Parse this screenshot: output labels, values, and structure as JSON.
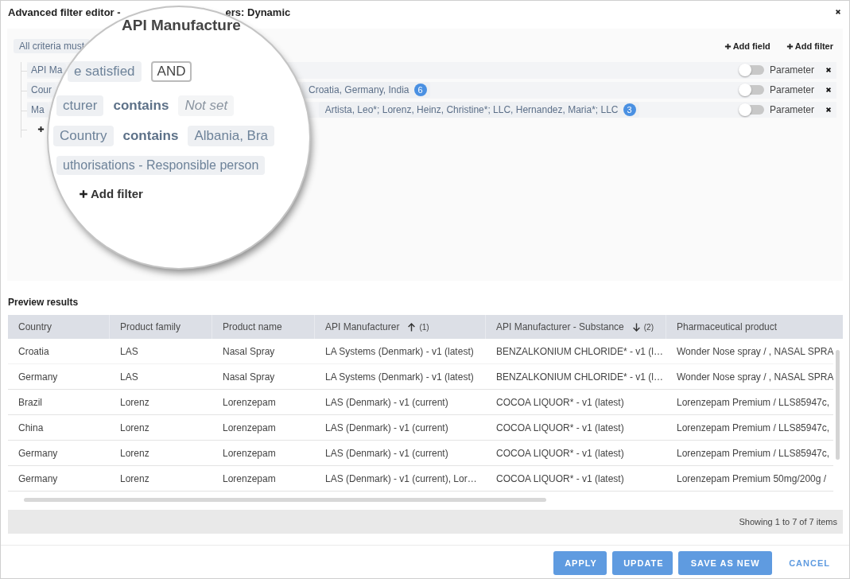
{
  "window": {
    "title_parts": [
      "Advanced filter editor -",
      "ers: Dynamic"
    ]
  },
  "filter": {
    "criteria": "All criteria must",
    "actions": [
      {
        "label": "Add field"
      },
      {
        "label": "Add filter"
      }
    ],
    "rows": [
      {
        "field": "API Ma",
        "parameter": "Parameter",
        "parameter_on": false
      },
      {
        "field": "Cour",
        "value": "Croatia, Germany, India",
        "count": "6",
        "parameter": "Parameter",
        "parameter_on": false
      },
      {
        "field": "Ma",
        "value": "Artista, Leo*; Lorenz, Heinz, Christine*; LLC, Hernandez, Maria*; LLC",
        "count": "3",
        "parameter": "Parameter",
        "parameter_on": false
      }
    ]
  },
  "magnifier": {
    "heading": "API Manufacture",
    "criteria": "e satisfied",
    "operator": "AND",
    "rows": [
      {
        "field": "cturer",
        "op": "contains",
        "value": "Not set",
        "kind": "placeholder"
      },
      {
        "field": "Country",
        "op": "contains",
        "value": "Albania, Bra",
        "kind": "text"
      },
      {
        "field": "uthorisations - Responsible person"
      }
    ],
    "add": "Add filter"
  },
  "preview": {
    "title": "Preview results",
    "columns": [
      {
        "label": "Country"
      },
      {
        "label": "Product family"
      },
      {
        "label": "Product name"
      },
      {
        "label": "API Manufacturer",
        "sorted": true,
        "descending": false,
        "sort_order": "(1)"
      },
      {
        "label": "API Manufacturer - Substance",
        "sorted": true,
        "descending": true,
        "sort_order": "(2)"
      },
      {
        "label": "Pharmaceutical product"
      }
    ],
    "rows": [
      [
        "Croatia",
        "LAS",
        "Nasal Spray",
        "LA Systems (Denmark) - v1 (latest)",
        "BENZALKONIUM CHLORIDE* - v1 (l…",
        "Wonder Nose spray / , NASAL SPRA"
      ],
      [
        "Germany",
        "LAS",
        "Nasal Spray",
        "LA Systems (Denmark) - v1 (latest)",
        "BENZALKONIUM CHLORIDE* - v1 (l…",
        "Wonder Nose spray / , NASAL SPRA"
      ],
      [
        "Brazil",
        "Lorenz",
        "Lorenzepam",
        "LAS (Denmark) - v1 (current)",
        "COCOA LIQUOR* - v1 (latest)",
        "Lorenzepam Premium / LLS85947c,"
      ],
      [
        "China",
        "Lorenz",
        "Lorenzepam",
        "LAS (Denmark) - v1 (current)",
        "COCOA LIQUOR* - v1 (latest)",
        "Lorenzepam Premium / LLS85947c,"
      ],
      [
        "Germany",
        "Lorenz",
        "Lorenzepam",
        "LAS (Denmark) - v1 (current)",
        "COCOA LIQUOR* - v1 (latest)",
        "Lorenzepam Premium / LLS85947c,"
      ],
      [
        "Germany",
        "Lorenz",
        "Lorenzepam",
        "LAS (Denmark) - v1 (current), Lor…",
        "COCOA LIQUOR* - v1 (latest)",
        "Lorenzepam Premium 50mg/200g /"
      ]
    ],
    "status": "Showing 1 to 7 of 7 items"
  },
  "buttons": [
    {
      "label": "APPLY",
      "kind": "primary"
    },
    {
      "label": "UPDATE",
      "kind": "primary"
    },
    {
      "label": "SAVE AS NEW",
      "kind": "primary"
    },
    {
      "label": "CANCEL",
      "kind": "link"
    }
  ]
}
